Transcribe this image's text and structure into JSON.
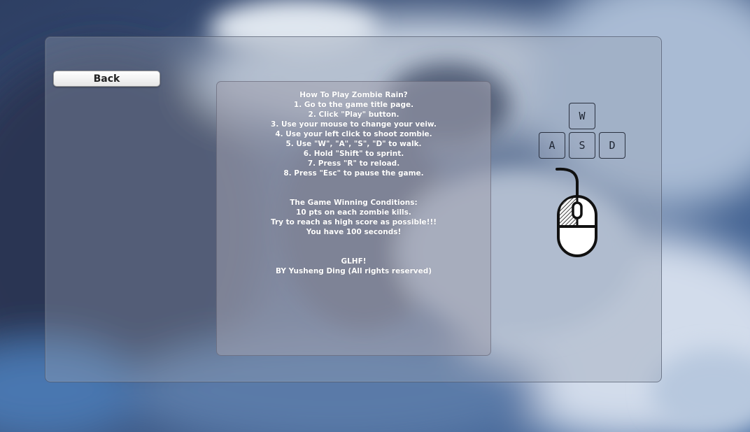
{
  "buttons": {
    "back_label": "Back"
  },
  "instructions": {
    "howto": [
      "How To Play Zombie Rain?",
      "1. Go to the game title page.",
      "2. Click \"Play\" button.",
      "3. Use your mouse to change your veiw.",
      "4. Use your left click to shoot zombie.",
      "5. Use \"W\", \"A\", \"S\", \"D\" to walk.",
      "6. Hold \"Shift\" to sprint.",
      "7. Press \"R\" to reload.",
      "8. Press \"Esc\" to pause the game."
    ],
    "conditions": [
      "The Game Winning Conditions:",
      "10 pts on each zombie kills.",
      "Try to reach as high score as possible!!!",
      "You have 100 seconds!"
    ],
    "credits": [
      "GLHF!",
      "BY Yusheng Ding (All rights reserved)"
    ]
  },
  "controls": {
    "keys": {
      "w": "W",
      "a": "A",
      "s": "S",
      "d": "D"
    },
    "mouse_icon": "mouse-left-click-icon"
  },
  "colors": {
    "panel": "#8f9ab0",
    "text": "#ffffff",
    "button_bg": "#ffffff"
  }
}
